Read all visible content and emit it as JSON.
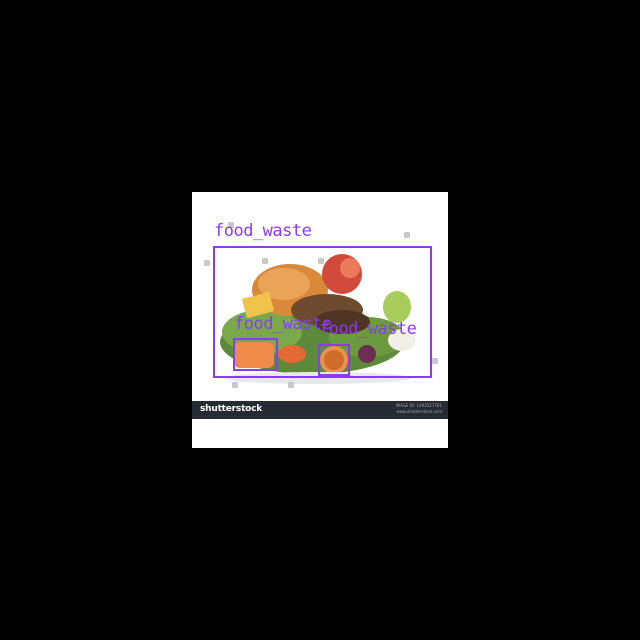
{
  "photo": {
    "stock_logo": "shutterstock",
    "stock_id_line1": "IMAGE ID: 1493527781",
    "stock_id_line2": "www.shutterstock.com"
  },
  "detections": [
    {
      "label": "food_waste",
      "color": "#8a3cf0"
    },
    {
      "label": "food_waste",
      "color": "#8a3cf0"
    },
    {
      "label": "food_waste",
      "color": "#8a3cf0"
    }
  ]
}
